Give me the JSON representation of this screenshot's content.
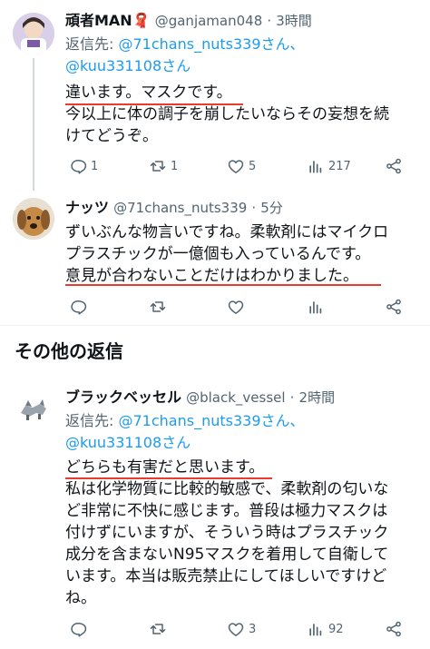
{
  "posts": [
    {
      "name": "頑者MAN🧣",
      "handle": "@ganjaman048",
      "time": "3時間",
      "reply_to": {
        "prefix": "返信先:",
        "handle1": "@71chans_nuts339さん、",
        "handle2": "@kuu331108さん"
      },
      "lines": [
        "違います。マスクです。",
        "今以上に体の調子を崩したいならその妄想を続",
        "けてどうぞ。"
      ],
      "actions": {
        "replies": "1",
        "reposts": "1",
        "likes": "5",
        "views": "217"
      }
    },
    {
      "name": "ナッツ",
      "handle": "@71chans_nuts339",
      "time": "5分",
      "lines": [
        "ずいぶんな物言いですね。柔軟剤にはマイクロ",
        "プラスチックが一億個も入っているんです。",
        "意見が合わないことだけはわかりました。"
      ],
      "actions": {
        "replies": "",
        "reposts": "",
        "likes": "",
        "views": ""
      }
    },
    {
      "name": "ブラックベッセル",
      "handle": "@black_vessel",
      "time": "2時間",
      "reply_to": {
        "prefix": "返信先:",
        "handle1": "@71chans_nuts339さん、",
        "handle2": "@kuu331108さん"
      },
      "lines": [
        "どちらも有害だと思います。",
        "私は化学物質に比較的敏感で、柔軟剤の匂いな",
        "ど非常に不快に感じます。普段は極力マスクは",
        "付けずにいますが、そういう時はプラスチック",
        "成分を含まないN95マスクを着用して自衛して",
        "います。本当は販売禁止にしてほしいですけど",
        "ね。"
      ],
      "actions": {
        "replies": "",
        "reposts": "",
        "likes": "3",
        "views": "92"
      }
    }
  ],
  "section_title": "その他の返信",
  "separator": "·",
  "colors": {
    "link": "#1d9bf0",
    "secondary": "#536471",
    "underline": "#ea3b2e",
    "thread_line": "#cfd9de"
  },
  "icons": [
    "reply-icon",
    "repost-icon",
    "like-icon",
    "views-icon",
    "share-icon"
  ]
}
